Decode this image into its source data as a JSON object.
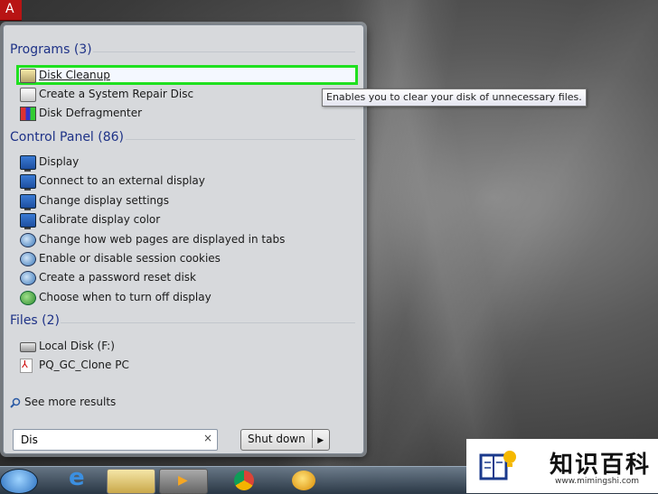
{
  "start_menu": {
    "sections": {
      "programs": {
        "title": "Programs (3)",
        "items": [
          {
            "label": "Disk Cleanup",
            "icon": "disk-cleanup-icon"
          },
          {
            "label": "Create a System Repair Disc",
            "icon": "repair-disc-icon"
          },
          {
            "label": "Disk Defragmenter",
            "icon": "defragmenter-icon"
          }
        ]
      },
      "control_panel": {
        "title": "Control Panel (86)",
        "items": [
          {
            "label": "Display",
            "icon": "monitor-icon"
          },
          {
            "label": "Connect to an external display",
            "icon": "monitor-icon"
          },
          {
            "label": "Change display settings",
            "icon": "monitor-icon"
          },
          {
            "label": "Calibrate display color",
            "icon": "monitor-icon"
          },
          {
            "label": "Change how web pages are displayed in tabs",
            "icon": "globe-icon"
          },
          {
            "label": "Enable or disable session cookies",
            "icon": "globe-icon"
          },
          {
            "label": "Create a password reset disk",
            "icon": "users-icon"
          },
          {
            "label": "Choose when to turn off display",
            "icon": "power-options-icon"
          }
        ]
      },
      "files": {
        "title": "Files (2)",
        "items": [
          {
            "label": "Local Disk (F:)",
            "icon": "drive-icon"
          },
          {
            "label": "PQ_GC_Clone PC",
            "icon": "pdf-icon"
          }
        ]
      }
    },
    "see_more": "See more results",
    "search": {
      "value": "Dis",
      "clear": "×"
    },
    "shutdown": {
      "label": "Shut down",
      "arrow": "▶"
    }
  },
  "tooltip": "Enables you to clear your disk of unnecessary files.",
  "highlight_color": "#1fe01f",
  "watermark": {
    "cn": "知识百科",
    "url": "www.mimingshi.com"
  }
}
